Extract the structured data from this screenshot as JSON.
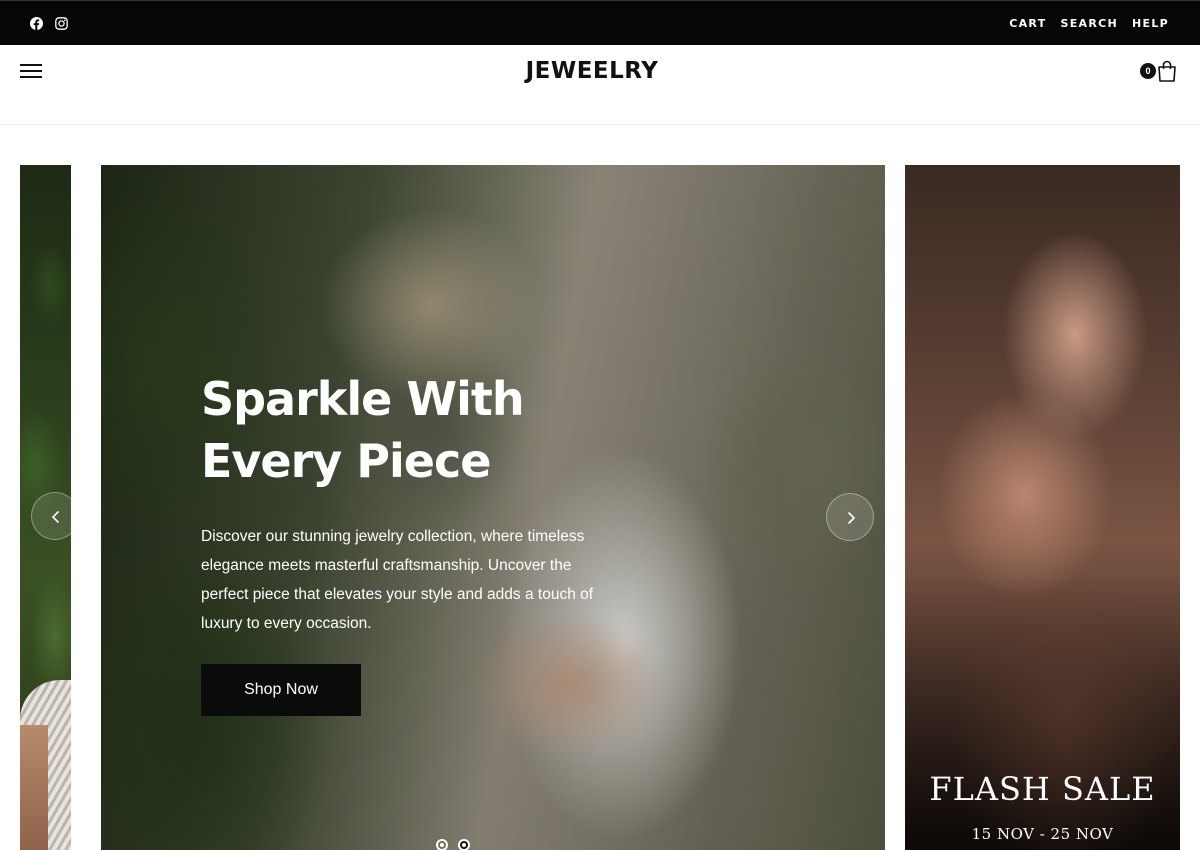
{
  "topbar": {
    "social": [
      {
        "name": "facebook-icon"
      },
      {
        "name": "instagram-icon"
      }
    ],
    "links": [
      "CART",
      "SEARCH",
      "HELP"
    ]
  },
  "header": {
    "logo": "JEWEELRY",
    "cart_count": "0"
  },
  "hero": {
    "title_line1": "Sparkle With",
    "title_line2": "Every Piece",
    "description": "Discover our stunning jewelry collection, where timeless elegance meets masterful craftsmanship. Uncover the perfect piece that elevates your style and adds a touch of luxury to every occasion.",
    "button_label": "Shop Now"
  },
  "promo": {
    "title": "FLASH SALE",
    "dates": "15 NOV - 25 NOV"
  },
  "carousel": {
    "slide_count": 2,
    "active_index": 1
  }
}
